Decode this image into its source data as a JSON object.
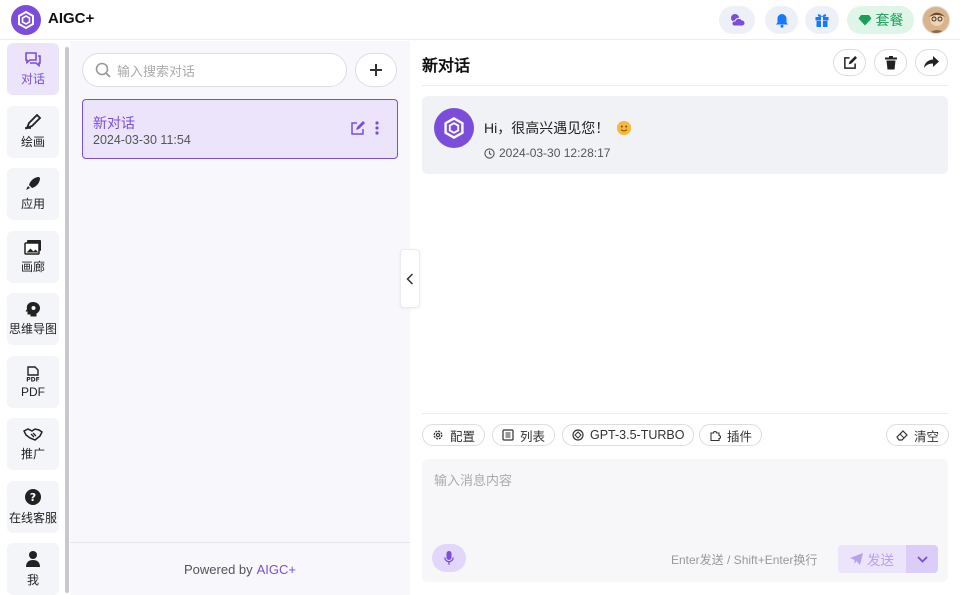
{
  "app": {
    "brand": "AIGC+"
  },
  "colors": {
    "accent": "#7c4ddb",
    "accent_light": "#ece4fb",
    "success": "#18a058"
  },
  "topbar": {
    "icons": [
      "weather-icon",
      "bell-icon",
      "gift-icon"
    ],
    "package_label": "套餐"
  },
  "nav": {
    "items": [
      {
        "label": "对话",
        "icon": "chat-icon",
        "active": true
      },
      {
        "label": "绘画",
        "icon": "brush-icon"
      },
      {
        "label": "应用",
        "icon": "rocket-icon"
      },
      {
        "label": "画廊",
        "icon": "gallery-icon"
      },
      {
        "label": "思维导图",
        "icon": "mindmap-icon"
      },
      {
        "label": "PDF",
        "icon": "pdf-icon"
      },
      {
        "label": "推广",
        "icon": "handshake-icon"
      },
      {
        "label": "在线客服",
        "icon": "help-icon"
      },
      {
        "label": "我",
        "icon": "user-icon"
      }
    ]
  },
  "sidebar": {
    "search_placeholder": "输入搜索对话",
    "conversations": [
      {
        "title": "新对话",
        "time": "2024-03-30 11:54"
      }
    ],
    "powered_by": "Powered by",
    "powered_link": "AIGC+"
  },
  "chat": {
    "title": "新对话",
    "messages": [
      {
        "text": "Hi，很高兴遇见您！",
        "time": "2024-03-30 12:28:17"
      }
    ],
    "toolbar": {
      "config": "配置",
      "list": "列表",
      "model": "GPT-3.5-TURBO",
      "plugins": "插件",
      "clear": "清空"
    },
    "input_placeholder": "输入消息内容",
    "hint": "Enter发送 / Shift+Enter换行",
    "send_label": "发送"
  }
}
